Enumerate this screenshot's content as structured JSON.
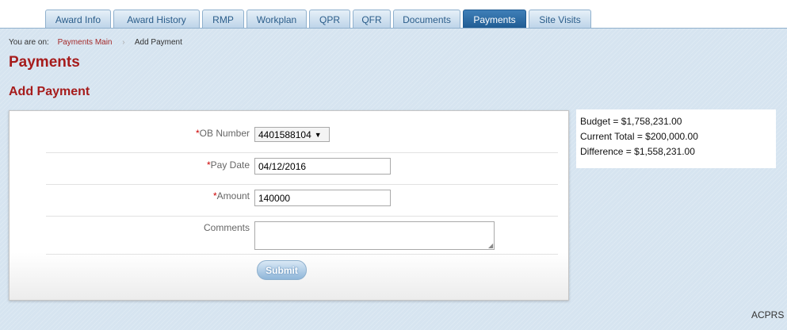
{
  "tabs": [
    {
      "label": "Award Info",
      "active": false
    },
    {
      "label": "Award History",
      "active": false
    },
    {
      "label": "RMP",
      "active": false
    },
    {
      "label": "Workplan",
      "active": false
    },
    {
      "label": "QPR",
      "active": false
    },
    {
      "label": "QFR",
      "active": false
    },
    {
      "label": "Documents",
      "active": false
    },
    {
      "label": "Payments",
      "active": true
    },
    {
      "label": "Site Visits",
      "active": false
    }
  ],
  "breadcrumb": {
    "prefix": "You are on:",
    "link": "Payments Main",
    "current": "Add Payment"
  },
  "page": {
    "title": "Payments",
    "subtitle": "Add Payment"
  },
  "form": {
    "required_marker": "*",
    "ob_number": {
      "label": "OB Number",
      "value": "4401588104",
      "arrow": "▼"
    },
    "pay_date": {
      "label": "Pay Date",
      "value": "04/12/2016"
    },
    "amount": {
      "label": "Amount",
      "value": "140000"
    },
    "comments": {
      "label": "Comments",
      "value": ""
    },
    "submit_label": "Submit"
  },
  "summary": {
    "budget": "Budget = $1,758,231.00",
    "current_total": "Current Total = $200,000.00",
    "difference": "Difference = $1,558,231.00"
  },
  "footer": {
    "text": "ACPRS"
  },
  "colors": {
    "heading": "#a61c1c",
    "active_tab": "#1f5b92",
    "background": "#d6e4f0"
  }
}
